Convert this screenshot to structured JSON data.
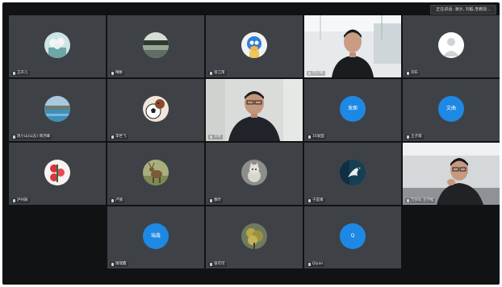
{
  "meeting": {
    "active_speaker": "正在讲话: 演示, 刘毅,李教授..."
  },
  "colors": {
    "frame": "#111213",
    "tile": "#3e4247",
    "initials_avatar": "#1e88e5"
  },
  "participants": [
    {
      "name": "王卉儿",
      "avatar": "photo-avatar-group"
    },
    {
      "name": "晴彬",
      "avatar": "photo-avatar-landscape"
    },
    {
      "name": "张江南",
      "avatar": "photo-avatar-cartoon"
    },
    {
      "name": "林学峰",
      "avatar": "live-video"
    },
    {
      "name": "刘乐",
      "avatar": "default-person-avatar"
    },
    {
      "name": "周小山(山东)-周河峰",
      "avatar": "photo-avatar-lake"
    },
    {
      "name": "李世飞",
      "avatar": "photo-avatar-soccer"
    },
    {
      "name": "李刚",
      "avatar": "live-video"
    },
    {
      "name": "16发面",
      "avatar": "initials-avatar",
      "initials": "发面"
    },
    {
      "name": "王子雨",
      "avatar": "initials-avatar",
      "initials": "文曲"
    },
    {
      "name": "泸州辰",
      "avatar": "photo-avatar-flowers"
    },
    {
      "name": "卢丽",
      "avatar": "photo-avatar-deer"
    },
    {
      "name": "春叶",
      "avatar": "photo-avatar-cat"
    },
    {
      "name": "于是绪",
      "avatar": "photo-avatar-bird"
    },
    {
      "name": "万岁队 王学松",
      "avatar": "live-video"
    },
    {
      "name": "",
      "avatar": "empty"
    },
    {
      "name": "谢瑞鑫",
      "avatar": "initials-avatar",
      "initials": "瑞鑫"
    },
    {
      "name": "张可可",
      "avatar": "photo-avatar-tree"
    },
    {
      "name": "Qiyan",
      "avatar": "initials-avatar",
      "initials": "Q"
    },
    {
      "name": "",
      "avatar": "empty"
    }
  ]
}
